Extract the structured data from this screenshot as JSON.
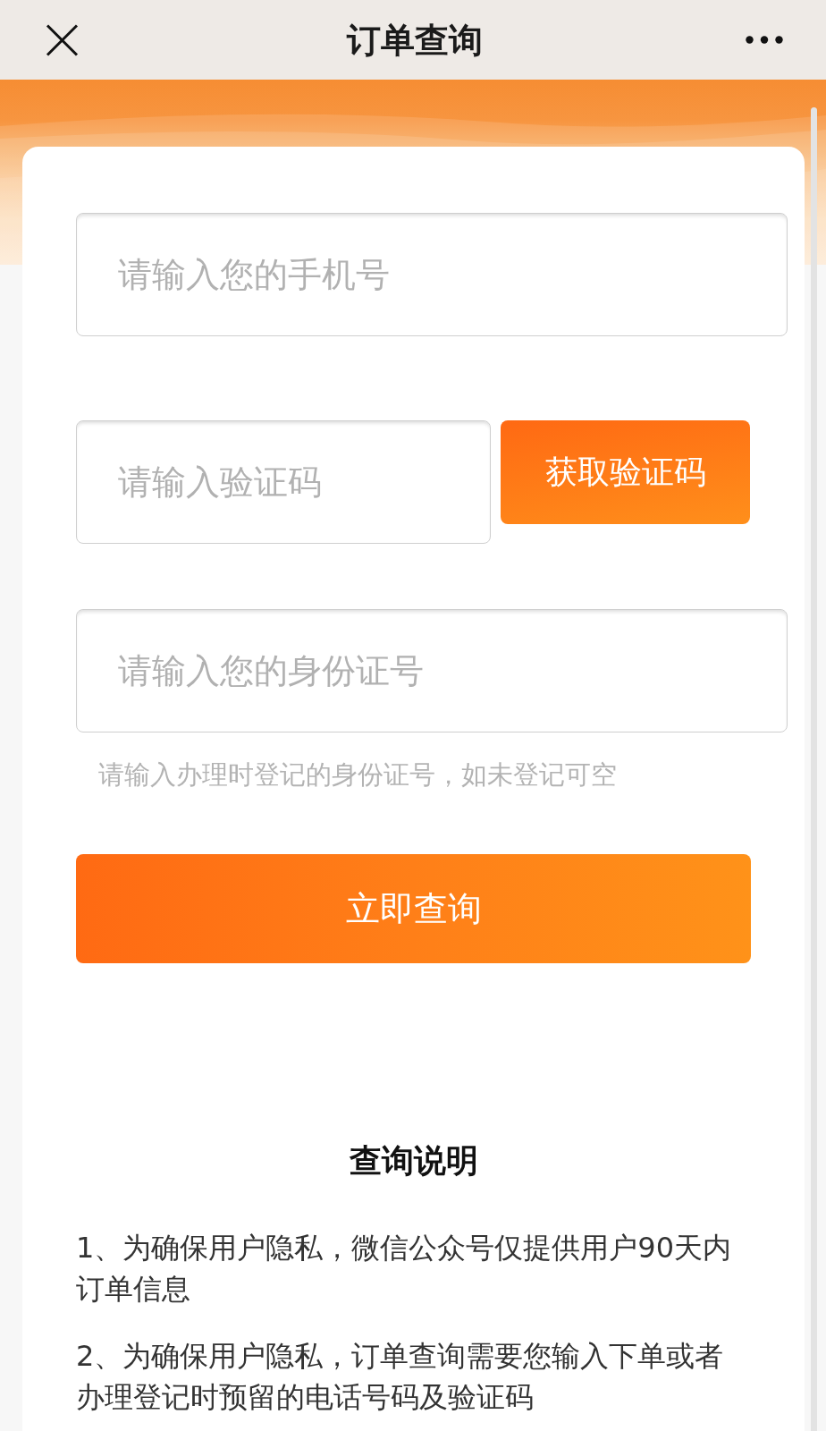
{
  "navbar": {
    "title": "订单查询"
  },
  "form": {
    "phone_field": {
      "placeholder": "请输入您的手机号"
    },
    "code_field": {
      "placeholder": "请输入验证码"
    },
    "code_button": {
      "label": "获取验证码"
    },
    "id_field": {
      "placeholder": "请输入您的身份证号"
    },
    "id_hint": "请输入办理时登记的身份证号，如未登记可空",
    "submit_button": {
      "label": "立即查询"
    }
  },
  "instructions": {
    "title": "查询说明",
    "items": [
      "1、为确保用户隐私，微信公众号仅提供用户90天内订单信息",
      "2、为确保用户隐私，订单查询需要您输入下单或者办理登记时预留的电话号码及验证码"
    ]
  }
}
